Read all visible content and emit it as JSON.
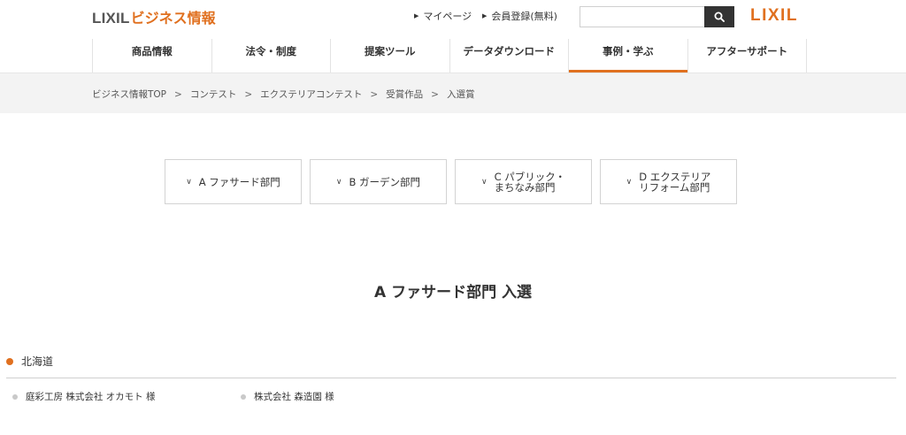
{
  "header": {
    "brand_lixil": "LIXIL",
    "brand_biz": "ビジネス情報",
    "util_links": [
      {
        "label": "マイページ"
      },
      {
        "label": "会員登録(無料)"
      }
    ],
    "search": {
      "value": "",
      "placeholder": ""
    },
    "logo_right": "LIXIL"
  },
  "gnav": {
    "items": [
      {
        "label": "商品情報"
      },
      {
        "label": "法令・制度"
      },
      {
        "label": "提案ツール"
      },
      {
        "label": "データダウンロード"
      },
      {
        "label": "事例・学ぶ"
      },
      {
        "label": "アフターサポート"
      }
    ],
    "active_index": 4
  },
  "breadcrumb": {
    "items": [
      "ビジネス情報TOP",
      "コンテスト",
      "エクステリアコンテスト",
      "受賞作品",
      "入選賞"
    ],
    "separator": ">"
  },
  "category_tabs": [
    {
      "lines": [
        "A ファサード部門"
      ]
    },
    {
      "lines": [
        "B ガーデン部門"
      ]
    },
    {
      "lines": [
        "C パブリック・",
        "まちなみ部門"
      ]
    },
    {
      "lines": [
        "D エクステリア",
        "リフォーム部門"
      ]
    }
  ],
  "section_title": "A ファサード部門 入選",
  "region": {
    "name": "北海道"
  },
  "winners": [
    {
      "name": "庭彩工房 株式会社 オカモト 様"
    },
    {
      "name": "株式会社 森造園 様"
    }
  ],
  "colors": {
    "accent": "#e0701f",
    "text": "#333333",
    "crumb_bg": "#f3f3f3"
  },
  "icons": {
    "tab_chevron": "chevron-down-icon",
    "search": "search-icon",
    "util_arrow": "triangle-right-icon"
  }
}
